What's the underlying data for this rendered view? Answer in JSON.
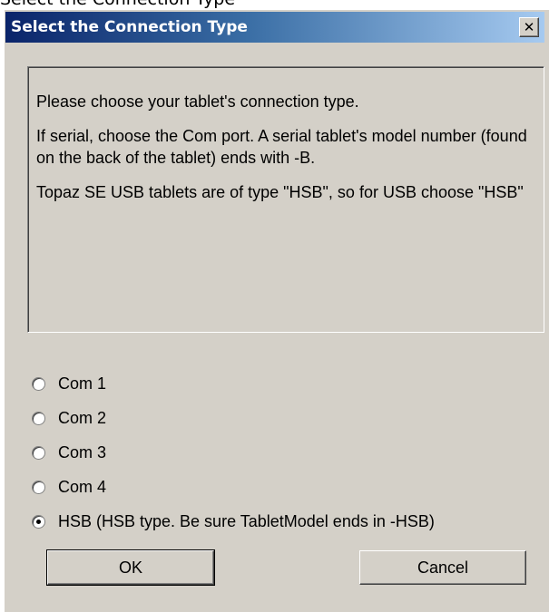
{
  "window": {
    "title": "Select the Connection Type",
    "close_glyph": "✕",
    "close_icon": "close-icon"
  },
  "info": {
    "line1": "Please choose your tablet's connection type.",
    "line2": "If serial, choose the Com port. A serial tablet's model number (found on the back of the tablet) ends with -B.",
    "line3": "Topaz SE USB tablets are of type \"HSB\", so for USB choose \"HSB\""
  },
  "options": [
    {
      "label": "Com 1",
      "checked": false
    },
    {
      "label": "Com 2",
      "checked": false
    },
    {
      "label": "Com 3",
      "checked": false
    },
    {
      "label": "Com 4",
      "checked": false
    },
    {
      "label": "HSB (HSB type. Be sure TabletModel ends in -HSB)",
      "checked": true
    }
  ],
  "buttons": {
    "ok_label": "OK",
    "cancel_label": "Cancel"
  },
  "colors": {
    "dialog_face": "#d4d0c8",
    "titlebar_start": "#0a246a",
    "titlebar_end": "#a6caf0"
  }
}
